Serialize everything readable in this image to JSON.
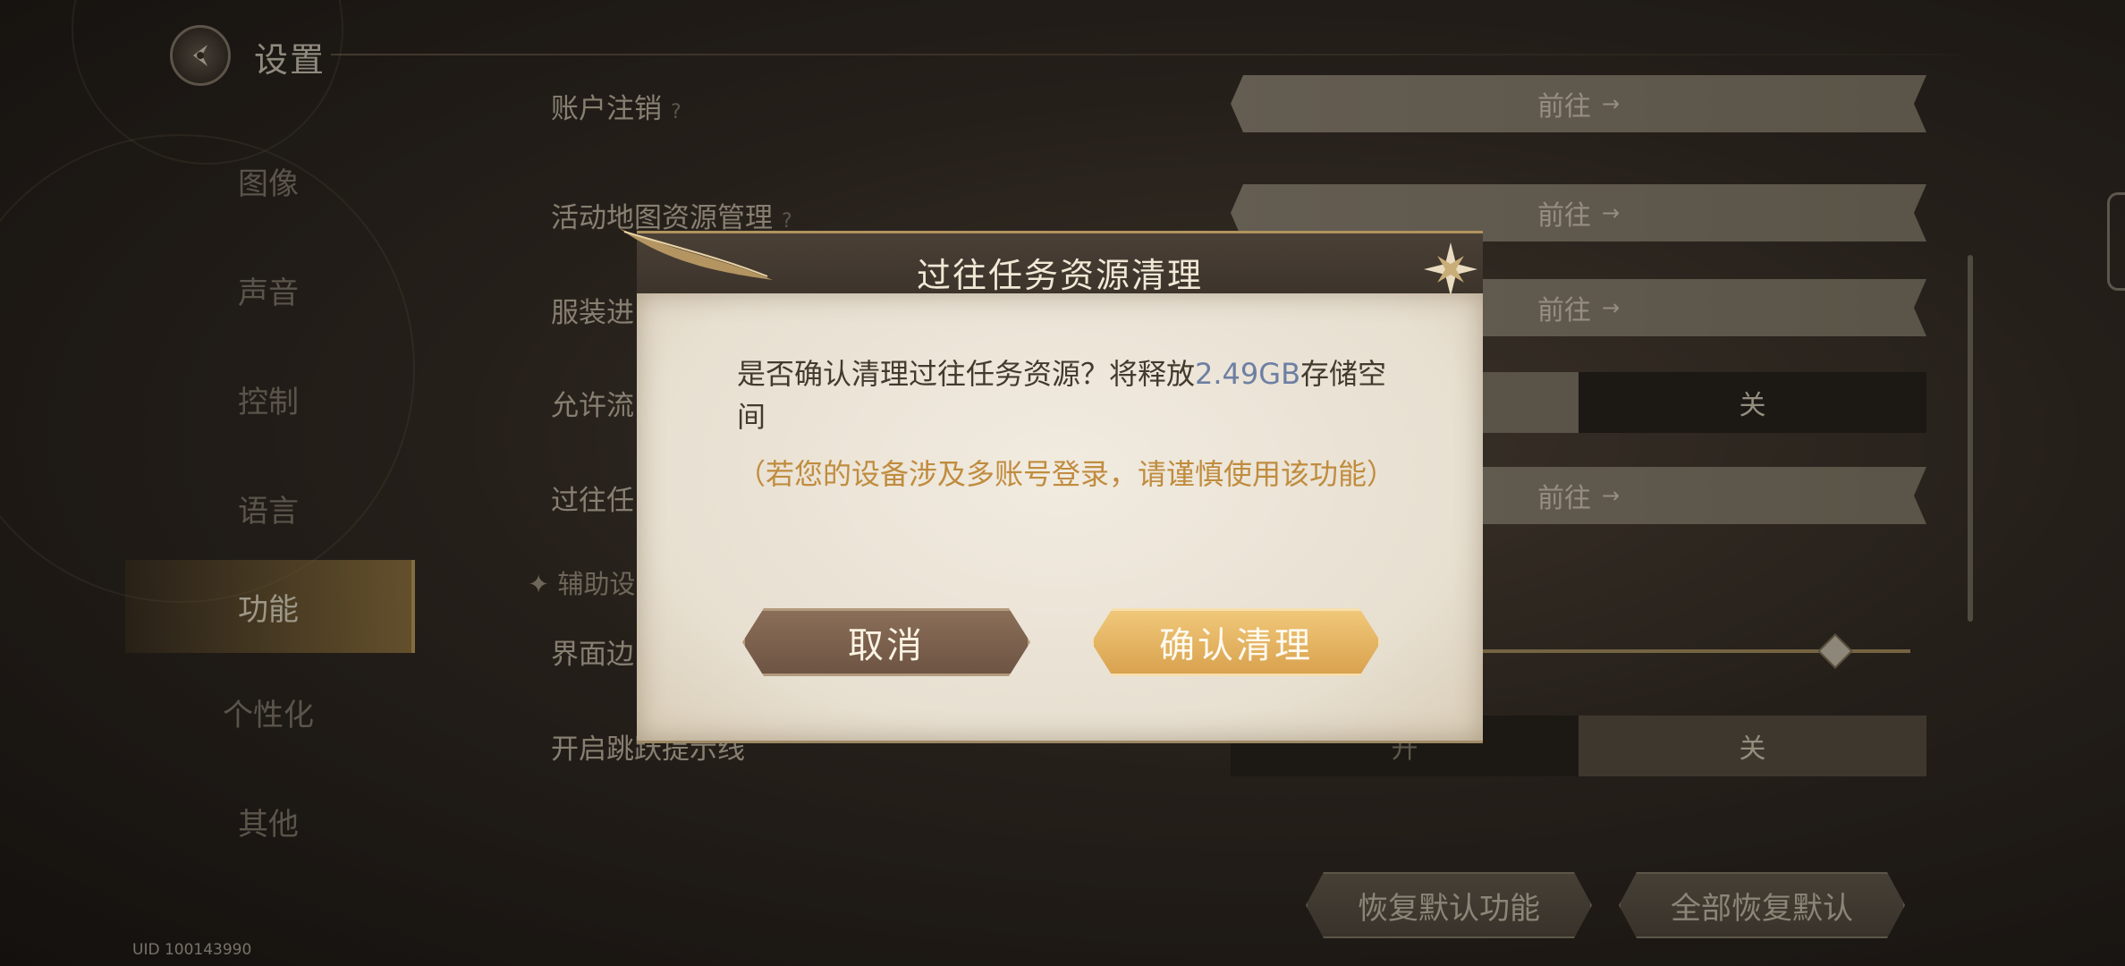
{
  "header": {
    "title": "设置"
  },
  "side_menu": {
    "items": [
      {
        "label": "图像"
      },
      {
        "label": "声音"
      },
      {
        "label": "控制"
      },
      {
        "label": "语言"
      },
      {
        "label": "功能",
        "active": true
      },
      {
        "label": "个性化"
      },
      {
        "label": "其他"
      }
    ]
  },
  "uid": "UID 100143990",
  "settings": {
    "rows": [
      {
        "label": "账户注销",
        "help": "?",
        "action": "前往"
      },
      {
        "label": "活动地图资源管理",
        "help": "?",
        "action": "前往"
      },
      {
        "label": "服装进",
        "action": "前往"
      },
      {
        "label": "允许流",
        "off_label": "关"
      },
      {
        "label": "过往任",
        "action": "前往"
      },
      {
        "label": "界面边"
      },
      {
        "label": "开启跳跃提示线",
        "on_label": "开",
        "off_label": "关"
      }
    ],
    "section_head": "辅助设"
  },
  "bottom_buttons": {
    "restore_function": "恢复默认功能",
    "restore_all": "全部恢复默认"
  },
  "dialog": {
    "title": "过往任务资源清理",
    "message_prefix": "是否确认清理过往任务资源？将释放",
    "message_size": "2.49GB",
    "message_suffix": "存储空间",
    "warning": "（若您的设备涉及多账号登录，请谨慎使用该功能）",
    "cancel_label": "取消",
    "confirm_label": "确认清理"
  },
  "colors": {
    "accent_gold": "#d9a24f",
    "size_highlight": "#6d7fa3",
    "warning_text": "#c08c3e"
  },
  "icons": {
    "back": "back-arrow-icon",
    "close": "star-close-icon",
    "goto_arrow": "→"
  }
}
